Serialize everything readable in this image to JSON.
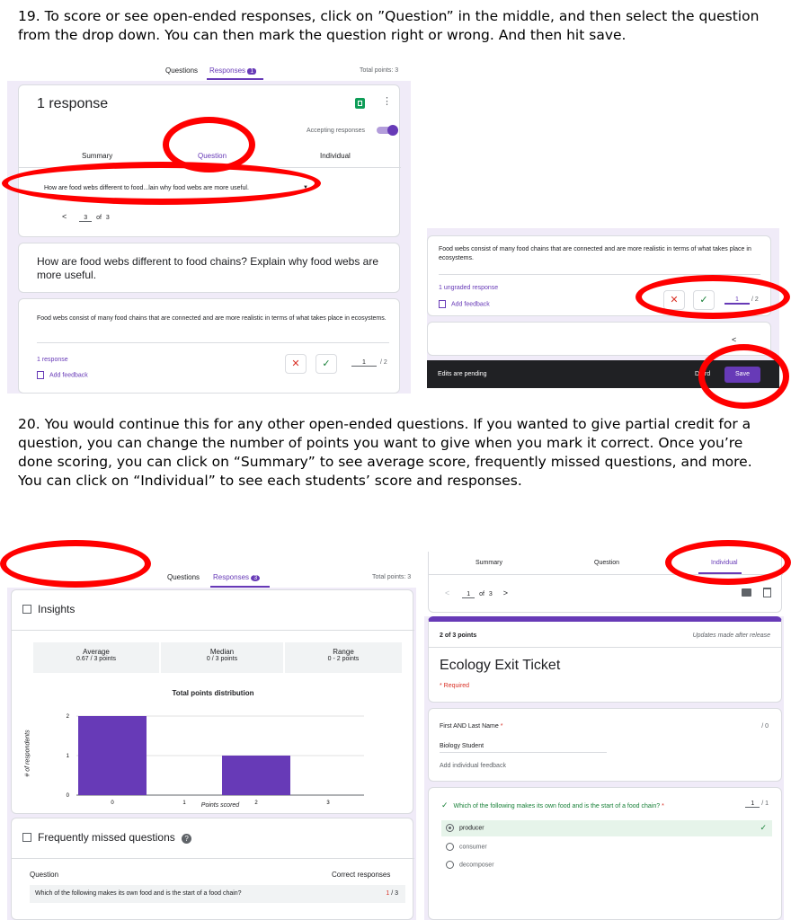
{
  "step19": "19. To score or see open-ended responses, click on ”Question” in the middle, and then select the question from the drop down.  You can then mark the question right or wrong. And then hit save.",
  "step20": "20. You would continue this for any other open-ended questions. If you wanted to give partial credit for a question, you can change the number of points you want to give when you mark it correct. Once you’re done scoring, you can click on “Summary” to see average score, frequently missed questions, and more. You can click on “Individual” to see each students’ score and responses.",
  "accent": "#673ab7",
  "highlight": "#ff0000",
  "shot1": {
    "tab_questions": "Questions",
    "tab_responses": "Responses",
    "responses_count": "1",
    "total_points": "Total points: 3",
    "title": "1 response",
    "accepting": "Accepting responses",
    "subtab_summary": "Summary",
    "subtab_question": "Question",
    "subtab_individual": "Individual",
    "dropdown": "How are food webs different to food...lain why food webs are more useful.",
    "pager_prev": "<",
    "pager_current": "3",
    "pager_of": "of",
    "pager_total": "3",
    "question_title": "How are food webs different to food chains? Explain why food webs are more useful.",
    "answer": "Food webs consist of many food chains that are connected and are more realistic in terms of what takes place in ecosystems.",
    "response_count": "1 response",
    "add_feedback": "Add feedback",
    "score": "1",
    "score_max": "/ 2"
  },
  "shot2": {
    "answer": "Food webs consist of many food chains that are connected and are more realistic in terms of what takes place in ecosystems.",
    "ungraded": "1 ungraded response",
    "add_feedback": "Add feedback",
    "score": "1",
    "score_max": "/ 2",
    "pager_prev": "<",
    "pending": "Edits are pending",
    "discard": "D   ard",
    "save": "Save"
  },
  "shot3": {
    "tab_questions": "Questions",
    "tab_responses": "Responses",
    "responses_count": "3",
    "total_points": "Total points: 3",
    "insights": "Insights",
    "stats": [
      {
        "label": "Average",
        "value": "0.67 / 3 points"
      },
      {
        "label": "Median",
        "value": "0 / 3 points"
      },
      {
        "label": "Range",
        "value": "0 - 2 points"
      }
    ],
    "frequently_missed": "Frequently missed questions",
    "col_question": "Question",
    "col_correct": "Correct responses",
    "missed_question": "Which of the following makes its own food and is the start of a food chain?",
    "missed_correct": "1",
    "missed_total": "/ 3"
  },
  "chart_data": {
    "type": "bar",
    "title": "Total points distribution",
    "xlabel": "Points scored",
    "ylabel": "# of respondents",
    "categories": [
      "0",
      "1",
      "2",
      "3"
    ],
    "values": [
      2,
      0,
      1,
      0
    ],
    "ylim": [
      0,
      2
    ],
    "yticks": [
      "0",
      "1",
      "2"
    ]
  },
  "shot4": {
    "subtab_summary": "Summary",
    "subtab_question": "Question",
    "subtab_individual": "Individual",
    "pager_prev": "<",
    "pager_current": "1",
    "pager_of": "of",
    "pager_total": "3",
    "pager_next": ">",
    "points": "2 of 3 points",
    "updates": "Updates made after release",
    "form_title": "Ecology Exit Ticket",
    "required": "* Required",
    "name_label": "First AND Last Name",
    "name_star": "*",
    "name_score": "/ 0",
    "name_answer": "Biology Student",
    "add_individual_feedback": "Add individual feedback",
    "q_text": "Which of the following makes its own food and is the start of a food chain?",
    "q_star": "*",
    "q_score": "1",
    "q_max": "/ 1",
    "options": [
      "producer",
      "consumer",
      "decomposer"
    ]
  }
}
